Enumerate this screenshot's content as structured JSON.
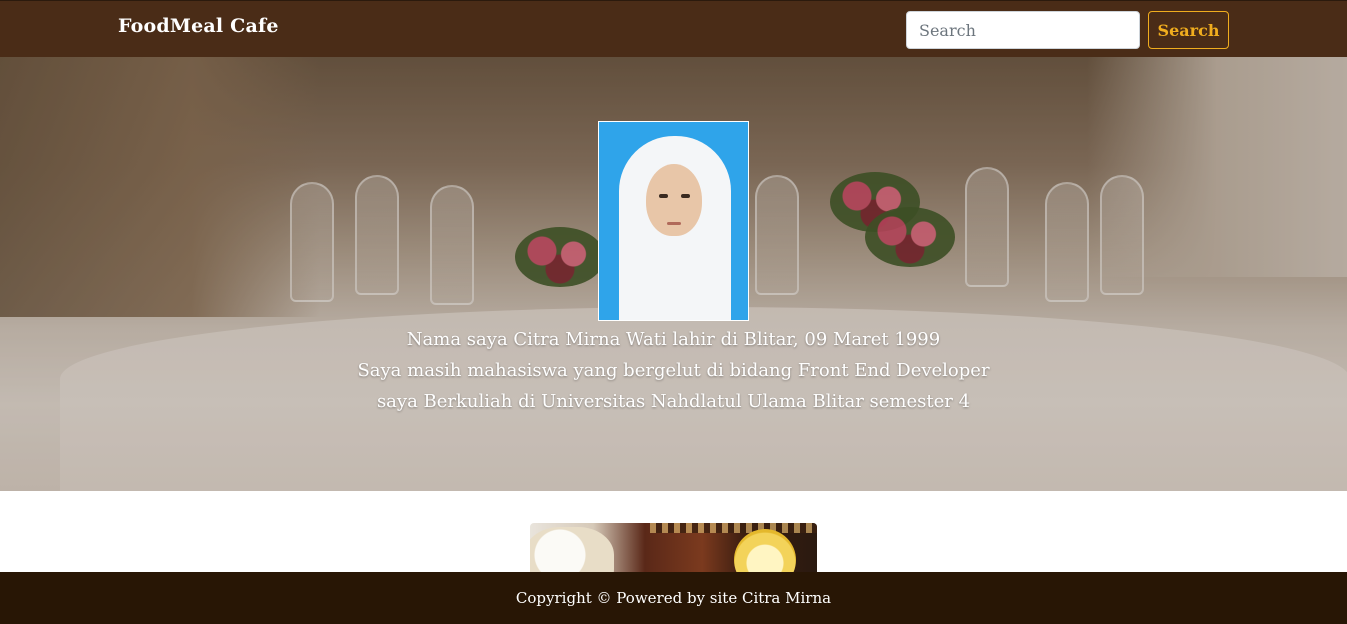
{
  "navbar": {
    "brand": "FoodMeal Cafe",
    "search_placeholder": "Search",
    "search_value": "",
    "search_button": "Search"
  },
  "hero": {
    "lines": [
      "Nama saya Citra Mirna Wati lahir di Blitar, 09 Maret 1999",
      "Saya masih mahasiswa yang bergelut di bidang Front End Developer",
      "saya Berkuliah di Universitas Nahdlatul Ulama Blitar semester 4"
    ]
  },
  "footer": {
    "text": "Copyright © Powered by site Citra Mirna"
  },
  "colors": {
    "navbar_bg": "#4a2c17",
    "accent": "#f0ad1e",
    "footer_bg": "#281605"
  },
  "icons": {
    "profile_photo": "profile-photo",
    "hero_background": "restaurant-table-image",
    "food_image": "food-image"
  }
}
